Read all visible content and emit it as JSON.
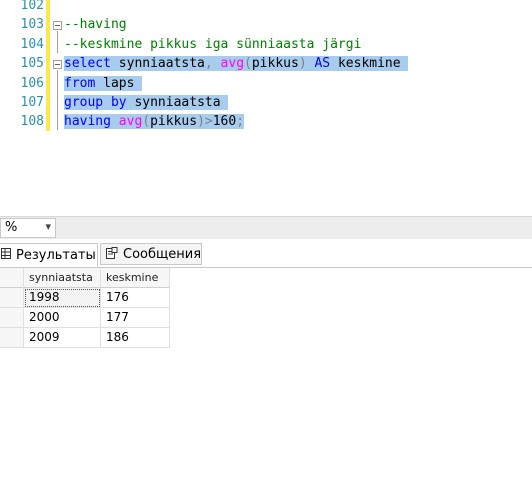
{
  "editor": {
    "line_numbers": [
      "102",
      "103",
      "104",
      "105",
      "106",
      "107",
      "108"
    ],
    "lines": {
      "l103": "--having",
      "l104": "--keskmine pikkus iga sünniaasta järgi",
      "l105": {
        "kw_select": "select",
        "t1": " synniaatsta",
        "op1": ",",
        "sp1": " ",
        "fn_avg": "avg",
        "op2": "(",
        "t2": "pikkus",
        "op3": ")",
        "sp2": " ",
        "kw_as": "AS",
        "t3": " keskmine "
      },
      "l106": {
        "kw_from": "from",
        "t1": " laps "
      },
      "l107": {
        "kw_group": "group",
        "sp": " ",
        "kw_by": "by",
        "t1": " synniaatsta "
      },
      "l108": {
        "kw_having": "having",
        "sp": " ",
        "fn_avg": "avg",
        "op1": "(",
        "t1": "pikkus",
        "op2": ")>",
        "t2": "160",
        "op3": ";"
      }
    }
  },
  "zoom": {
    "value": "%",
    "arrow": "▾"
  },
  "tabs": [
    {
      "label": "Результаты",
      "icon": "grid-icon"
    },
    {
      "label": "Сообщения",
      "icon": "messages-icon"
    }
  ],
  "results": {
    "columns": [
      "synniaatsta",
      "keskmine"
    ],
    "rows": [
      [
        "1998",
        "176"
      ],
      [
        "2000",
        "177"
      ],
      [
        "2009",
        "186"
      ]
    ]
  }
}
